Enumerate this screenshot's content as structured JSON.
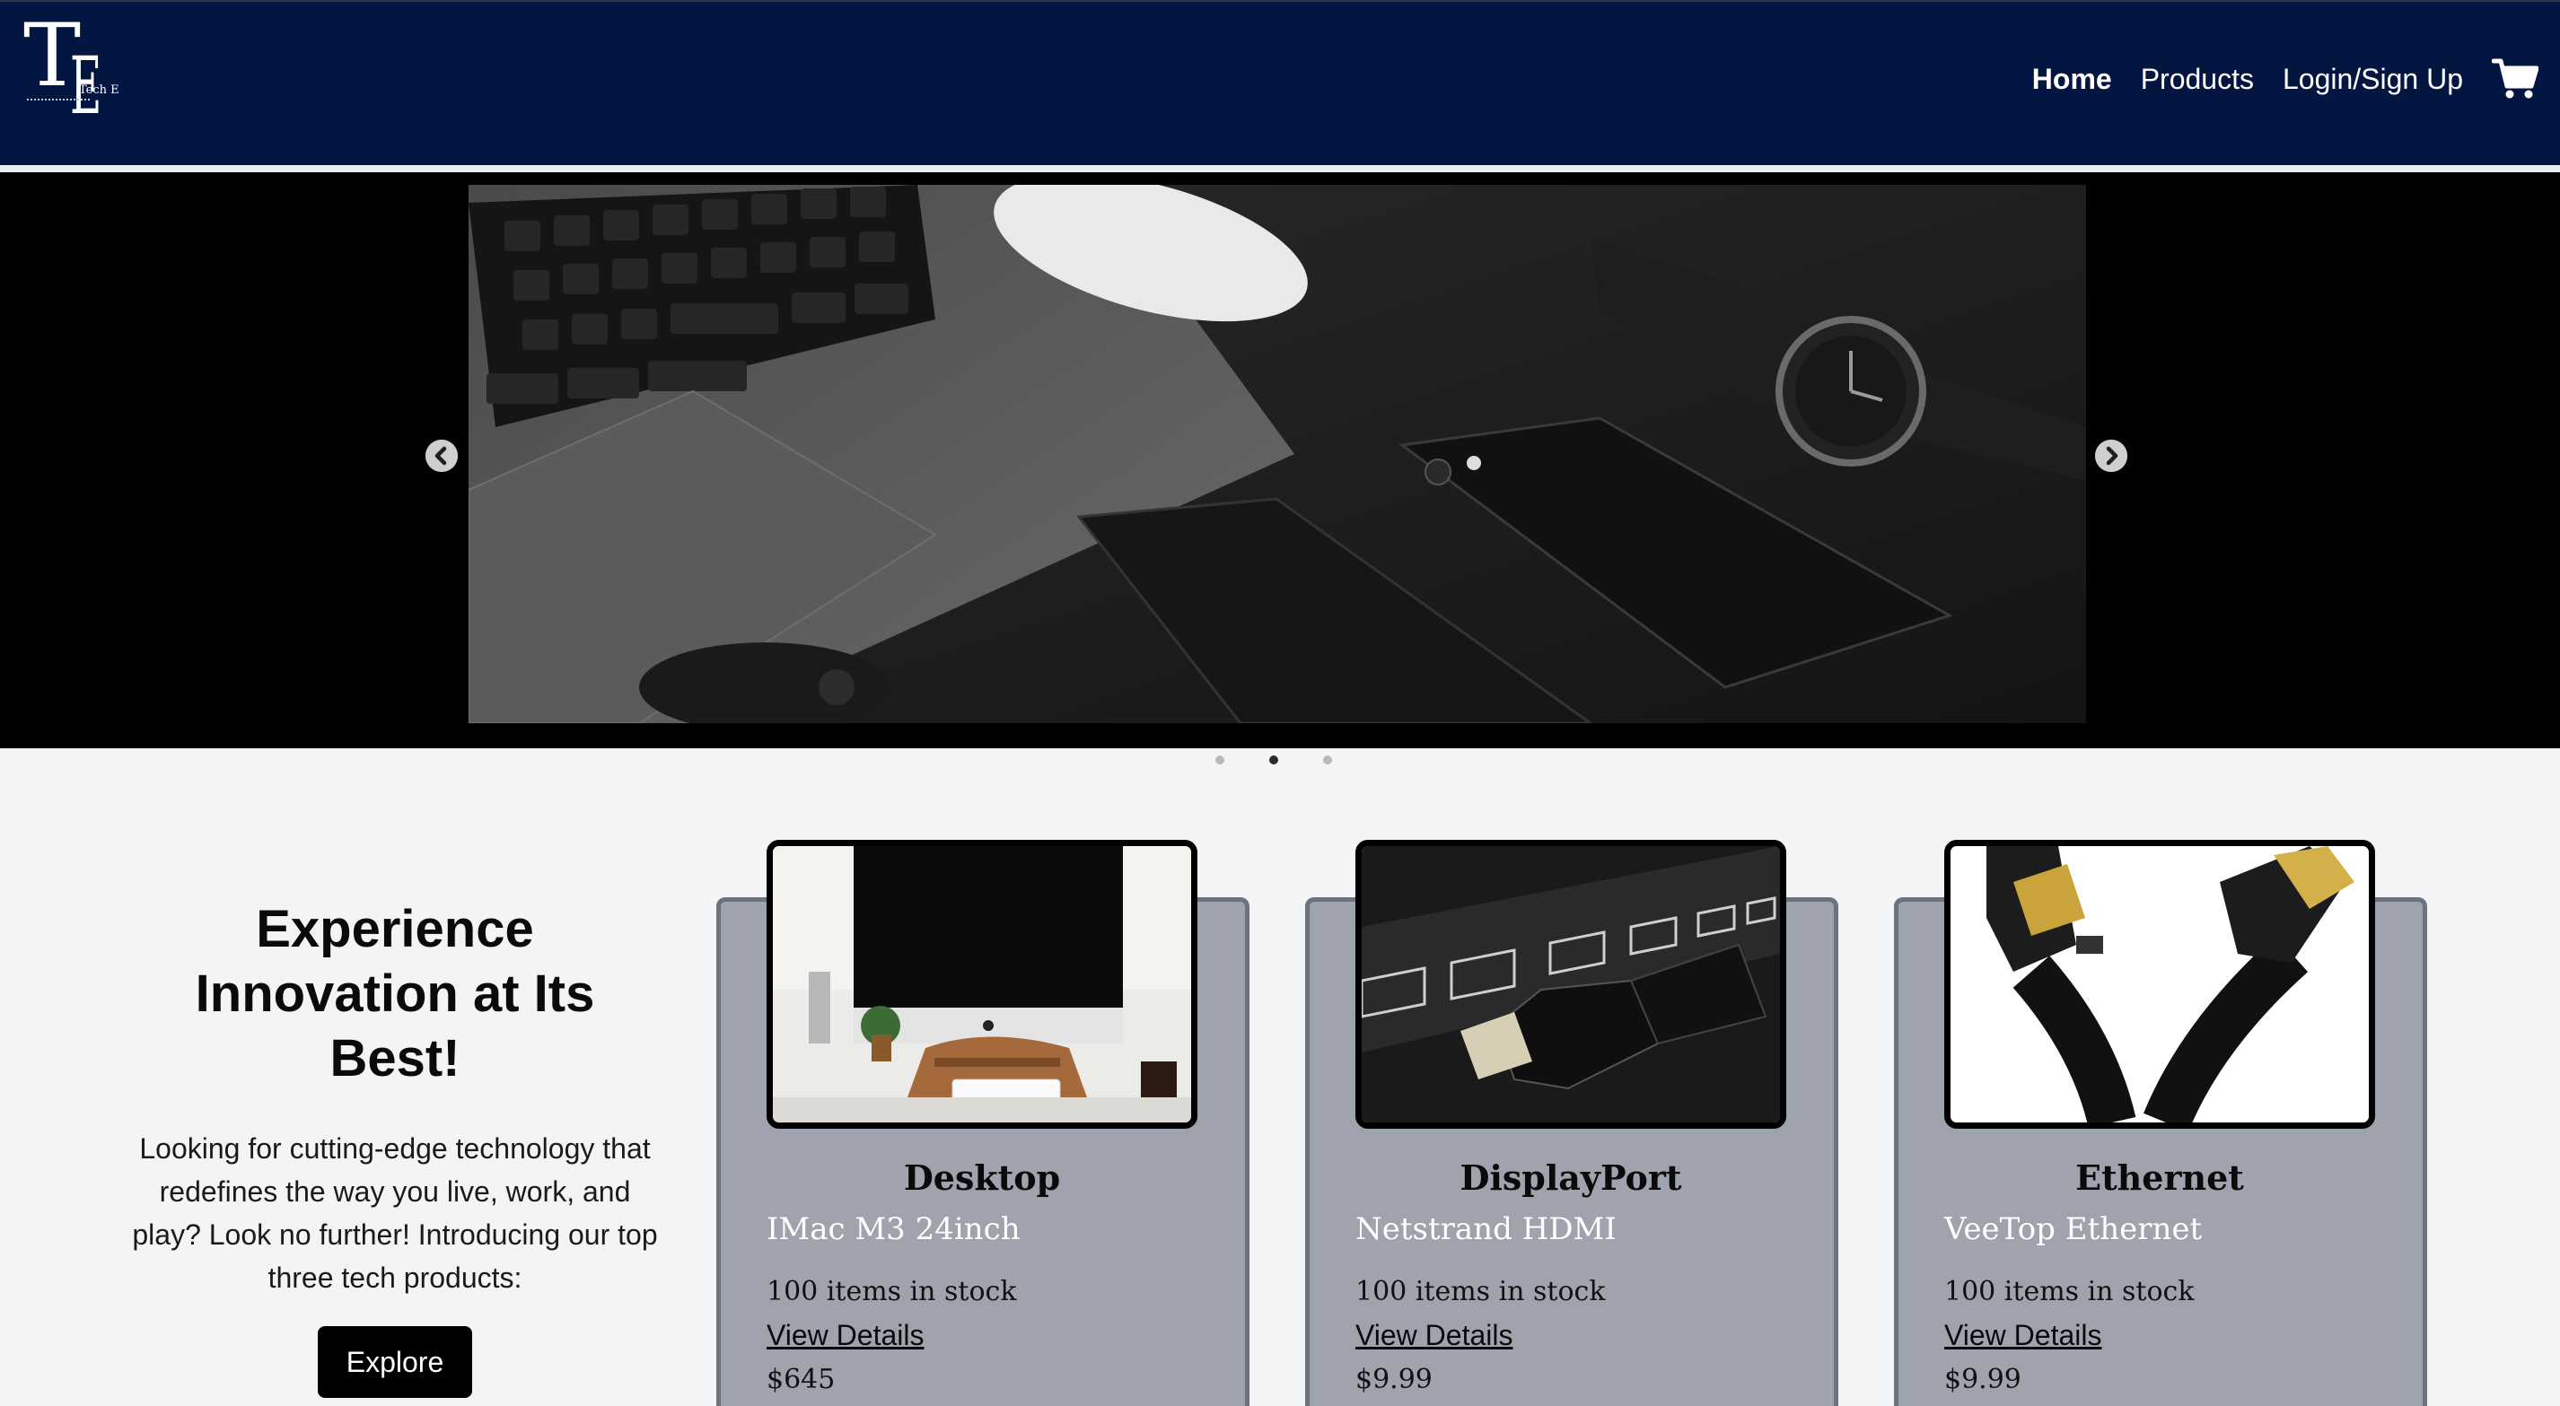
{
  "brand": {
    "logo_letters": "TE",
    "logo_subtext": "Tech E"
  },
  "nav": {
    "items": [
      {
        "label": "Home",
        "active": true
      },
      {
        "label": "Products",
        "active": false
      },
      {
        "label": "Login/Sign Up",
        "active": false
      }
    ],
    "cart_icon": "shopping-cart-icon"
  },
  "carousel": {
    "slide_count": 3,
    "active_slide": 2,
    "prev_icon": "chevron-left-icon",
    "next_icon": "chevron-right-icon",
    "image_subject": "laptop, mouse, phones and watch on dark desk"
  },
  "promo": {
    "heading": "Experience Innovation at Its Best!",
    "text": "Looking for cutting-edge technology that redefines the way you live, work, and play? Look no further! Introducing our top three tech products:",
    "button_label": "Explore"
  },
  "products": [
    {
      "category": "Desktop",
      "name": "IMac M3 24inch",
      "stock": "100 items in stock",
      "link": "View Details",
      "price": "$645"
    },
    {
      "category": "DisplayPort",
      "name": "Netstrand HDMI",
      "stock": "100 items in stock",
      "link": "View Details",
      "price": "$9.99"
    },
    {
      "category": "Ethernet",
      "name": "VeeTop Ethernet",
      "stock": "100 items in stock",
      "link": "View Details",
      "price": "$9.99"
    }
  ],
  "colors": {
    "navbar_bg": "#031642",
    "page_bg": "#f3f4f6",
    "card_bg": "#9ea3ad",
    "card_border": "#6c737f",
    "button_bg": "#000000"
  }
}
